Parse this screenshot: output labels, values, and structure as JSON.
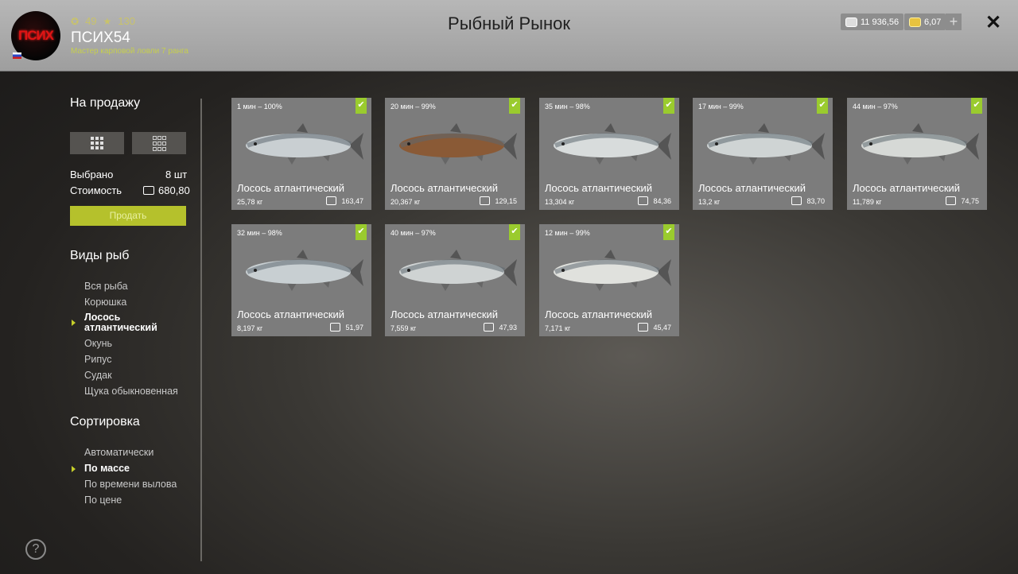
{
  "header": {
    "title": "Рыбный Рынок",
    "avatar_text": "ПСИХ",
    "username": "ПСИХ54",
    "rank": "Мастер карповой ловли 7 ранга",
    "stat_coins": "49",
    "stat_stars": "130",
    "silver": "11 936,56",
    "gold": "6,07"
  },
  "sidebar": {
    "for_sale_title": "На продажу",
    "selected_label": "Выбрано",
    "selected_value": "8 шт",
    "cost_label": "Стоимость",
    "cost_value": "680,80",
    "sell_button": "Продать",
    "fish_types_title": "Виды рыб",
    "fish_types": [
      "Вся рыба",
      "Корюшка",
      "Лосось атлантический",
      "Окунь",
      "Рипус",
      "Судак",
      "Щука обыкновенная"
    ],
    "sort_title": "Сортировка",
    "sort_options": [
      "Автоматически",
      "По массе",
      "По времени вылова",
      "По цене"
    ],
    "help": "?"
  },
  "cards": [
    {
      "meta": "1 мин – 100%",
      "name": "Лосось атлантический",
      "weight": "25,78 кг",
      "price": "163,47",
      "color": "#c9cfd2"
    },
    {
      "meta": "20 мин – 99%",
      "name": "Лосось атлантический",
      "weight": "20,367 кг",
      "price": "129,15",
      "color": "#8a5a36"
    },
    {
      "meta": "35 мин – 98%",
      "name": "Лосось атлантический",
      "weight": "13,304 кг",
      "price": "84,36",
      "color": "#d8dcdc"
    },
    {
      "meta": "17 мин – 99%",
      "name": "Лосось атлантический",
      "weight": "13,2 кг",
      "price": "83,70",
      "color": "#cfd4d4"
    },
    {
      "meta": "44 мин – 97%",
      "name": "Лосось атлантический",
      "weight": "11,789 кг",
      "price": "74,75",
      "color": "#d6d9d6"
    },
    {
      "meta": "32 мин – 98%",
      "name": "Лосось атлантический",
      "weight": "8,197 кг",
      "price": "51,97",
      "color": "#c8cfd2"
    },
    {
      "meta": "40 мин – 97%",
      "name": "Лосось атлантический",
      "weight": "7,559 кг",
      "price": "47,93",
      "color": "#cfd3d3"
    },
    {
      "meta": "12 мин – 99%",
      "name": "Лосось атлантический",
      "weight": "7,171 кг",
      "price": "45,47",
      "color": "#e0e1dd"
    }
  ]
}
